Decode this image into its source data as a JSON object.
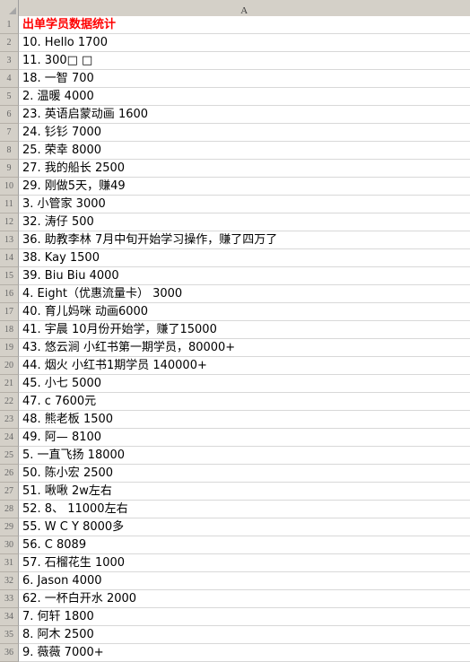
{
  "app": {
    "type": "spreadsheet",
    "title": "出单学员数据统计"
  },
  "grid": {
    "corner_label": "select-all",
    "columns": [
      {
        "label": "A"
      }
    ],
    "row_numbers": [
      "1",
      "2",
      "3",
      "4",
      "5",
      "6",
      "7",
      "8",
      "9",
      "10",
      "11",
      "12",
      "13",
      "14",
      "15",
      "16",
      "17",
      "18",
      "19",
      "20",
      "21",
      "22",
      "23",
      "24",
      "25",
      "26",
      "27",
      "28",
      "29",
      "30",
      "31",
      "32",
      "33",
      "34",
      "35",
      "36"
    ],
    "rows": [
      {
        "num": "1",
        "value": "出单学员数据统计",
        "style": "title"
      },
      {
        "num": "2",
        "value": "10. Hello 1700",
        "style": "normal"
      },
      {
        "num": "3",
        "value": "11.  300□  □",
        "style": "normal"
      },
      {
        "num": "4",
        "value": "18. 一智 700",
        "style": "normal"
      },
      {
        "num": "5",
        "value": "2. 温暖 4000",
        "style": "normal"
      },
      {
        "num": "6",
        "value": "23. 英语启蒙动画 1600",
        "style": "normal"
      },
      {
        "num": "7",
        "value": "24. 钐钐 7000",
        "style": "normal"
      },
      {
        "num": "8",
        "value": "25. 荣幸 8000",
        "style": "normal"
      },
      {
        "num": "9",
        "value": "27. 我的船长 2500",
        "style": "normal"
      },
      {
        "num": "10",
        "value": "29. 刚做5天，赚49",
        "style": "normal"
      },
      {
        "num": "11",
        "value": "3. 小管家 3000",
        "style": "normal"
      },
      {
        "num": "12",
        "value": "32. 涛仔 500",
        "style": "normal"
      },
      {
        "num": "13",
        "value": "36. 助教李林 7月中旬开始学习操作，赚了四万了",
        "style": "normal"
      },
      {
        "num": "14",
        "value": "38. Kay 1500",
        "style": "normal"
      },
      {
        "num": "15",
        "value": "39. Biu Biu  4000",
        "style": "normal"
      },
      {
        "num": "16",
        "value": "4. Eight（优惠流量卡） 3000",
        "style": "normal"
      },
      {
        "num": "17",
        "value": "40. 育儿妈咪 动画6000",
        "style": "normal"
      },
      {
        "num": "18",
        "value": "41. 宇晨 10月份开始学，赚了15000",
        "style": "normal"
      },
      {
        "num": "19",
        "value": "43. 悠云涧 小红书第一期学员，80000+",
        "style": "normal"
      },
      {
        "num": "20",
        "value": "44. 烟火 小红书1期学员 140000+",
        "style": "normal"
      },
      {
        "num": "21",
        "value": "45. 小七 5000",
        "style": "normal"
      },
      {
        "num": "22",
        "value": "47. c 7600元",
        "style": "normal"
      },
      {
        "num": "23",
        "value": "48. 熊老板 1500",
        "style": "normal"
      },
      {
        "num": "24",
        "value": "49. 阿— 8100",
        "style": "normal"
      },
      {
        "num": "25",
        "value": "5. 一直飞扬 18000",
        "style": "normal"
      },
      {
        "num": "26",
        "value": "50. 陈小宏 2500",
        "style": "normal"
      },
      {
        "num": "27",
        "value": "51. 啾啾 2w左右",
        "style": "normal"
      },
      {
        "num": "28",
        "value": "52. 8、 11000左右",
        "style": "normal"
      },
      {
        "num": "29",
        "value": "55. W C Y 8000多",
        "style": "normal"
      },
      {
        "num": "30",
        "value": "56. C  8089",
        "style": "normal"
      },
      {
        "num": "31",
        "value": "57. 石榴花生 1000",
        "style": "normal"
      },
      {
        "num": "32",
        "value": "6. Jason 4000",
        "style": "normal"
      },
      {
        "num": "33",
        "value": "62. 一杯白开水 2000",
        "style": "normal"
      },
      {
        "num": "34",
        "value": "7. 何轩 1800",
        "style": "normal"
      },
      {
        "num": "35",
        "value": "8. 阿木 2500",
        "style": "normal"
      },
      {
        "num": "36",
        "value": "9. 薇薇 7000+",
        "style": "normal"
      }
    ]
  },
  "colors": {
    "title_text": "#ff0000",
    "header_background": "#d4d0c8",
    "gridline": "#d8d8d8",
    "cell_text": "#000000",
    "row_number_text": "#666666"
  }
}
